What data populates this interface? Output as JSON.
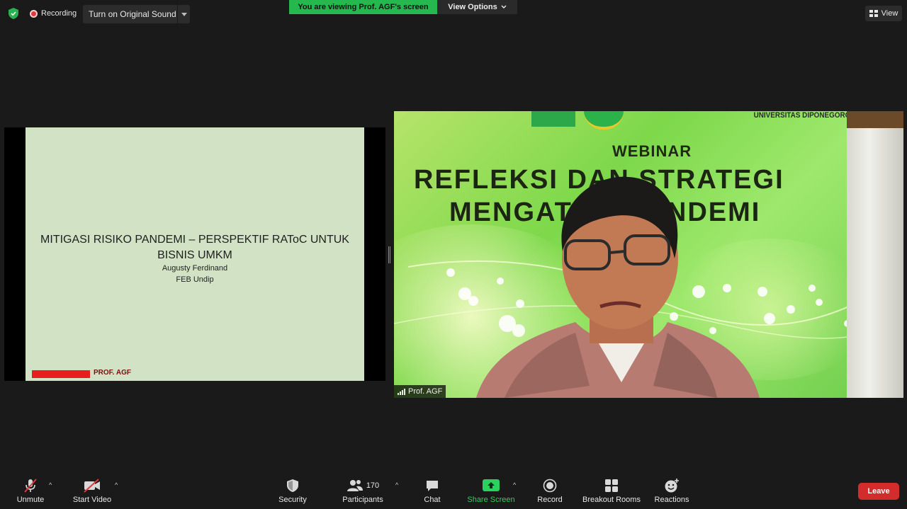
{
  "top_bar": {
    "recording_label": "Recording",
    "original_sound_button": "Turn on Original Sound",
    "viewing_banner": "You are viewing Prof. AGF's screen",
    "view_options": "View Options",
    "view_button": "View"
  },
  "main": {
    "shared_slide": {
      "title": "MITIGASI RISIKO PANDEMI – PERSPEKTIF RAToC UNTUK BISNIS UMKM",
      "author": "Augusty Ferdinand",
      "institution": "FEB Undip",
      "brand": "PROF. AGF"
    },
    "speaker_video": {
      "name_tag": "Prof. AGF",
      "backdrop_university": "UNIVERSITAS DIPONEGORO",
      "backdrop_webinar": "WEBINAR",
      "backdrop_line1": "REFLEKSI DAN STRATEGI",
      "backdrop_line2": "MENGATASI PANDEMI"
    }
  },
  "toolbar": {
    "unmute": "Unmute",
    "start_video": "Start Video",
    "security": "Security",
    "participants": "Participants",
    "participants_count": "170",
    "chat": "Chat",
    "share_screen": "Share Screen",
    "record": "Record",
    "breakout_rooms": "Breakout Rooms",
    "reactions": "Reactions",
    "leave": "Leave"
  },
  "colors": {
    "background": "#1a1a1a",
    "viewing_banner": "#25b84f",
    "share_screen": "#2bd15c",
    "leave": "#d32c2c",
    "slide_bg": "#d2e3c5"
  }
}
